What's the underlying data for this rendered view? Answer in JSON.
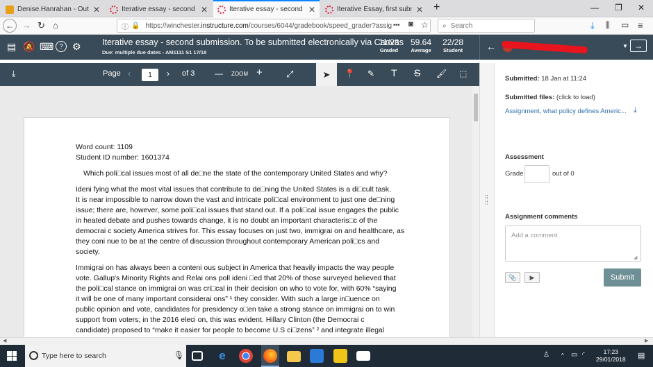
{
  "browser": {
    "tabs": [
      {
        "title": "Denise.Hanrahan - Outlook Web",
        "active": false,
        "color": "#e8a019"
      },
      {
        "title": "Iterative essay - second submission",
        "active": false,
        "color": "#e0243e"
      },
      {
        "title": "Iterative essay - second submission",
        "active": true,
        "color": "#e0243e"
      },
      {
        "title": "Iterative Essay, first submission",
        "active": false,
        "color": "#e0243e"
      }
    ],
    "new_tab": "+",
    "url_prefix": "https://winchester.",
    "url_domain": "instructure.com",
    "url_path": "/courses/6044/gradebook/speed_grader?assig",
    "url_more": "•••",
    "search_placeholder": "Search"
  },
  "header": {
    "assignment_title": "Iterative essay - second submission. To be submitted electronically via Canvas",
    "due": "Due: multiple due dates - AM1111 S1 17/18",
    "stats": [
      {
        "value": "11/28",
        "label": "Graded"
      },
      {
        "value": "59.64",
        "label": "Average"
      },
      {
        "value": "22/28",
        "label": "Student"
      }
    ]
  },
  "pdf_toolbar": {
    "page_label": "Page",
    "page_value": "1",
    "page_of": "of 3",
    "zoom_label": "ZOOM"
  },
  "document": {
    "lines": [
      "Word count: 1109",
      "Student ID number: 1601374",
      "Which poli□cal issues most of all de□ne the state of the contemporary United States and why?",
      "Ideni fying what the most vital issues that contribute to de□ning the United States is a di□cult task.",
      "It is near impossible to narrow down the vast and intricate poli□cal environment to just one de□ning",
      "issue; there are, however, some poli□cal issues that stand out. If a poli□cal issue engages the public",
      "in heated debate and pushes towards change, it is no doubt an important characteris□c of the",
      "democrai c society America strives for. This essay focuses on just two, immigrai on and healthcare, as",
      "they coni nue to be at the centre of discussion throughout contemporary American poli□cs and",
      "society.",
      "Immigrai on has always been a conteni ous subject in America that heavily impacts the way people",
      "vote.  Gallup's Minority Rights and Relai ons poll ideni □ed that 20% of those surveyed believed that",
      "the poli□cal stance on immigrai on was cri□cal in their decision on who to vote for, with 60% “saying",
      "it will be one of many important considerai ons” ¹ they consider.  With such a large in□uence on",
      "public opinion and vote, candidates for presidency o□en take a strong stance on immigrai on to win",
      "support from voters; in the 2016 eleci on, this was evident.  Hillary Clinton (the Democrai c",
      "candidate) proposed to “make it easier for people to become U.S ci□zens” ² and integrate illegal"
    ]
  },
  "panel": {
    "submitted_label": "Submitted:",
    "submitted_value": "18 Jan at 11:24",
    "files_label": "Submitted files:",
    "files_hint": "(click to load)",
    "file_link": "Assignment, what policy defines Americ...",
    "assessment": "Assessment",
    "grade_label": "Grade",
    "grade_out_of": "out of 0",
    "comments_heading": "Assignment comments",
    "comment_placeholder": "Add a comment",
    "submit_label": "Submit"
  },
  "taskbar": {
    "search_text": "Type here to search",
    "time": "17:23",
    "date": "29/01/2018"
  }
}
